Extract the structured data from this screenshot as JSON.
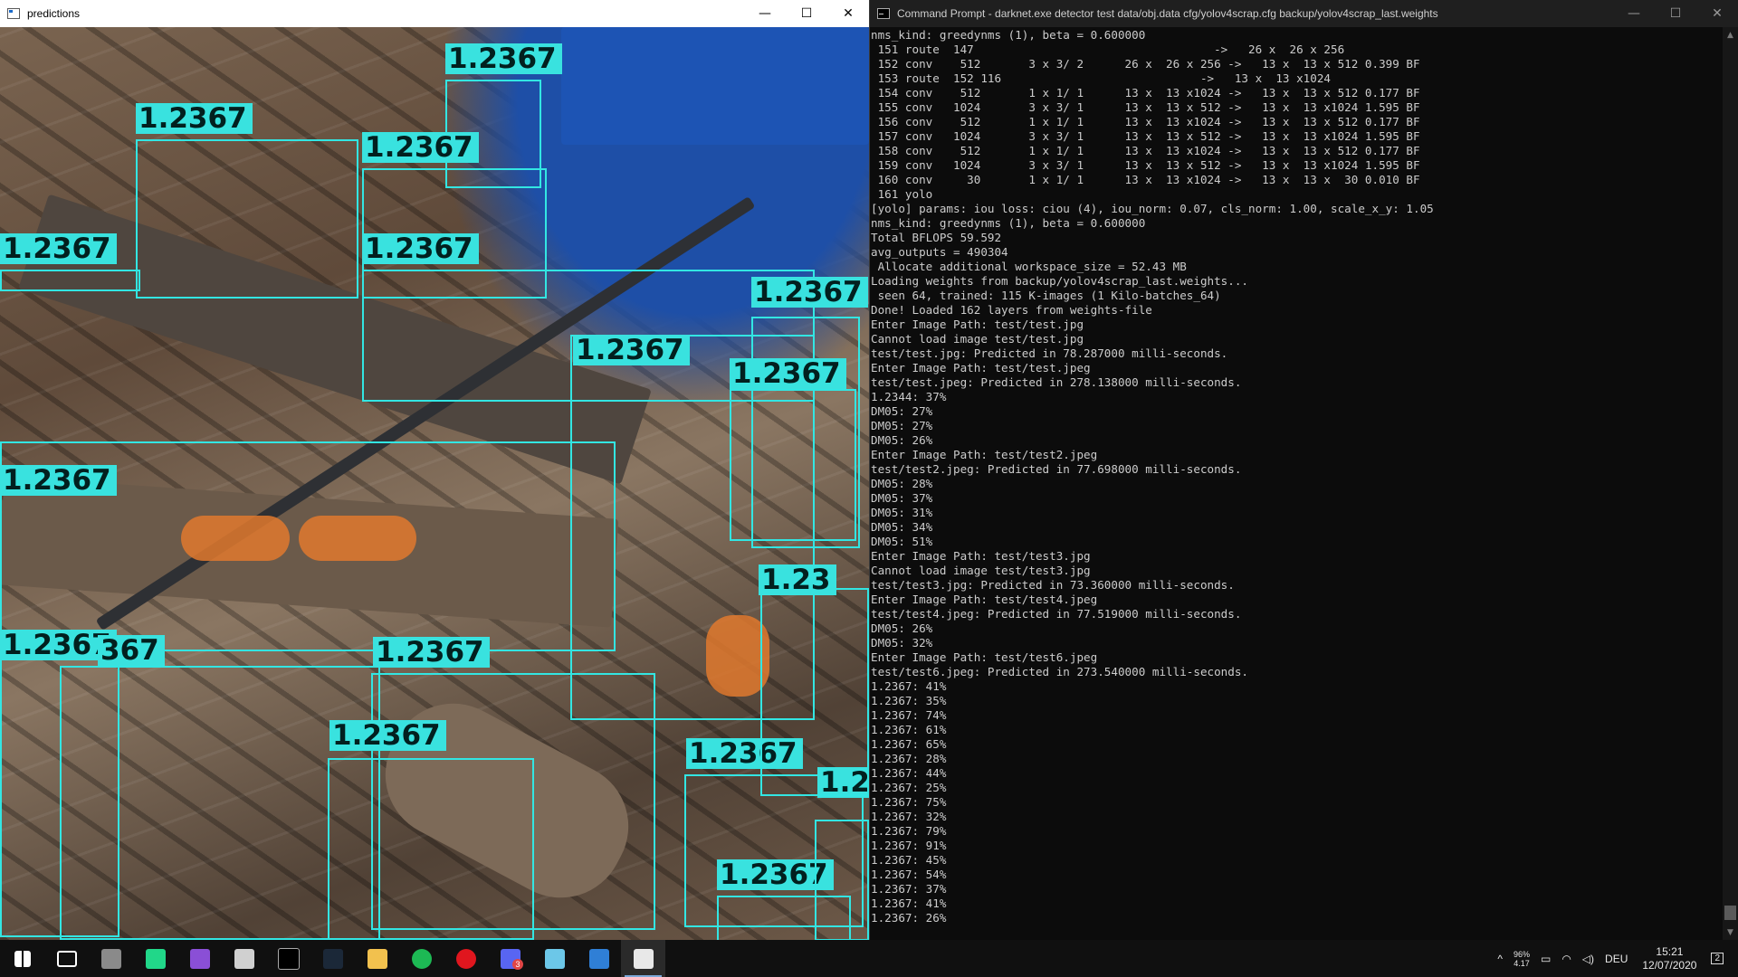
{
  "predictions_window": {
    "title": "predictions",
    "minimize": "—",
    "maximize": "☐",
    "close": "✕"
  },
  "detection_boxes": [
    {
      "label": "1.2367"
    },
    {
      "label": "1.2367"
    },
    {
      "label": "1.2367"
    },
    {
      "label": "1.2367"
    },
    {
      "label": "1.2367"
    },
    {
      "label": "1.2367"
    },
    {
      "label": "1.2367"
    },
    {
      "label": "1.2367"
    },
    {
      "label": "1.2367"
    },
    {
      "label": "1.2367"
    },
    {
      "label": "367"
    },
    {
      "label": "1.2367"
    },
    {
      "label": "1.2367"
    },
    {
      "label": "1.2367"
    },
    {
      "label": "1.2367"
    },
    {
      "label": "1.2367"
    },
    {
      "label": "1.23"
    }
  ],
  "cmd_window": {
    "title": "Command Prompt - darknet.exe  detector test data/obj.data cfg/yolov4scrap.cfg backup/yolov4scrap_last.weights",
    "minimize": "—",
    "maximize": "☐",
    "close": "✕",
    "output": [
      "nms_kind: greedynms (1), beta = 0.600000",
      " 151 route  147                                   ->   26 x  26 x 256",
      " 152 conv    512       3 x 3/ 2      26 x  26 x 256 ->   13 x  13 x 512 0.399 BF",
      " 153 route  152 116                             ->   13 x  13 x1024",
      " 154 conv    512       1 x 1/ 1      13 x  13 x1024 ->   13 x  13 x 512 0.177 BF",
      " 155 conv   1024       3 x 3/ 1      13 x  13 x 512 ->   13 x  13 x1024 1.595 BF",
      " 156 conv    512       1 x 1/ 1      13 x  13 x1024 ->   13 x  13 x 512 0.177 BF",
      " 157 conv   1024       3 x 3/ 1      13 x  13 x 512 ->   13 x  13 x1024 1.595 BF",
      " 158 conv    512       1 x 1/ 1      13 x  13 x1024 ->   13 x  13 x 512 0.177 BF",
      " 159 conv   1024       3 x 3/ 1      13 x  13 x 512 ->   13 x  13 x1024 1.595 BF",
      " 160 conv     30       1 x 1/ 1      13 x  13 x1024 ->   13 x  13 x  30 0.010 BF",
      " 161 yolo",
      "[yolo] params: iou loss: ciou (4), iou_norm: 0.07, cls_norm: 1.00, scale_x_y: 1.05",
      "nms_kind: greedynms (1), beta = 0.600000",
      "Total BFLOPS 59.592",
      "avg_outputs = 490304",
      " Allocate additional workspace_size = 52.43 MB",
      "Loading weights from backup/yolov4scrap_last.weights...",
      " seen 64, trained: 115 K-images (1 Kilo-batches_64)",
      "Done! Loaded 162 layers from weights-file",
      "Enter Image Path: test/test.jpg",
      "Cannot load image test/test.jpg",
      "test/test.jpg: Predicted in 78.287000 milli-seconds.",
      "Enter Image Path: test/test.jpeg",
      "test/test.jpeg: Predicted in 278.138000 milli-seconds.",
      "1.2344: 37%",
      "DM05: 27%",
      "DM05: 27%",
      "DM05: 26%",
      "Enter Image Path: test/test2.jpeg",
      "test/test2.jpeg: Predicted in 77.698000 milli-seconds.",
      "DM05: 28%",
      "DM05: 37%",
      "DM05: 31%",
      "DM05: 34%",
      "DM05: 51%",
      "Enter Image Path: test/test3.jpg",
      "Cannot load image test/test3.jpg",
      "test/test3.jpg: Predicted in 73.360000 milli-seconds.",
      "Enter Image Path: test/test4.jpeg",
      "test/test4.jpeg: Predicted in 77.519000 milli-seconds.",
      "DM05: 26%",
      "DM05: 32%",
      "Enter Image Path: test/test6.jpeg",
      "test/test6.jpeg: Predicted in 273.540000 milli-seconds.",
      "1.2367: 41%",
      "1.2367: 35%",
      "1.2367: 74%",
      "1.2367: 61%",
      "1.2367: 65%",
      "1.2367: 28%",
      "1.2367: 44%",
      "1.2367: 25%",
      "1.2367: 75%",
      "1.2367: 32%",
      "1.2367: 79%",
      "1.2367: 91%",
      "1.2367: 45%",
      "1.2367: 54%",
      "1.2367: 37%",
      "1.2367: 41%",
      "1.2367: 26%"
    ]
  },
  "taskbar": {
    "apps": [
      {
        "name": "start-icon",
        "color": "#ffffff"
      },
      {
        "name": "task-view-icon",
        "color": "#ffffff"
      },
      {
        "name": "app-icon",
        "color": "#8a8a8a"
      },
      {
        "name": "pycharm-icon",
        "color": "#21d789"
      },
      {
        "name": "visual-studio-icon",
        "color": "#8a4fd6"
      },
      {
        "name": "window-icon",
        "color": "#d0d0d0"
      },
      {
        "name": "terminal-icon",
        "color": "#000000"
      },
      {
        "name": "steam-icon",
        "color": "#1b2838"
      },
      {
        "name": "file-explorer-icon",
        "color": "#f2c14e"
      },
      {
        "name": "spotify-icon",
        "color": "#1db954"
      },
      {
        "name": "opera-icon",
        "color": "#e0161e"
      },
      {
        "name": "chat-icon",
        "color": "#5865f2"
      },
      {
        "name": "pencil-app-icon",
        "color": "#6cc7e8"
      },
      {
        "name": "photos-icon",
        "color": "#2f7fd6"
      },
      {
        "name": "predictions-window-icon",
        "color": "#e8e8e8"
      }
    ],
    "chat_badge": "3",
    "tray": {
      "chevron": "^",
      "temp": "96%",
      "temp2": "4.17",
      "language": "DEU",
      "time": "15:21",
      "date": "12/07/2020",
      "notifications": "2"
    }
  }
}
